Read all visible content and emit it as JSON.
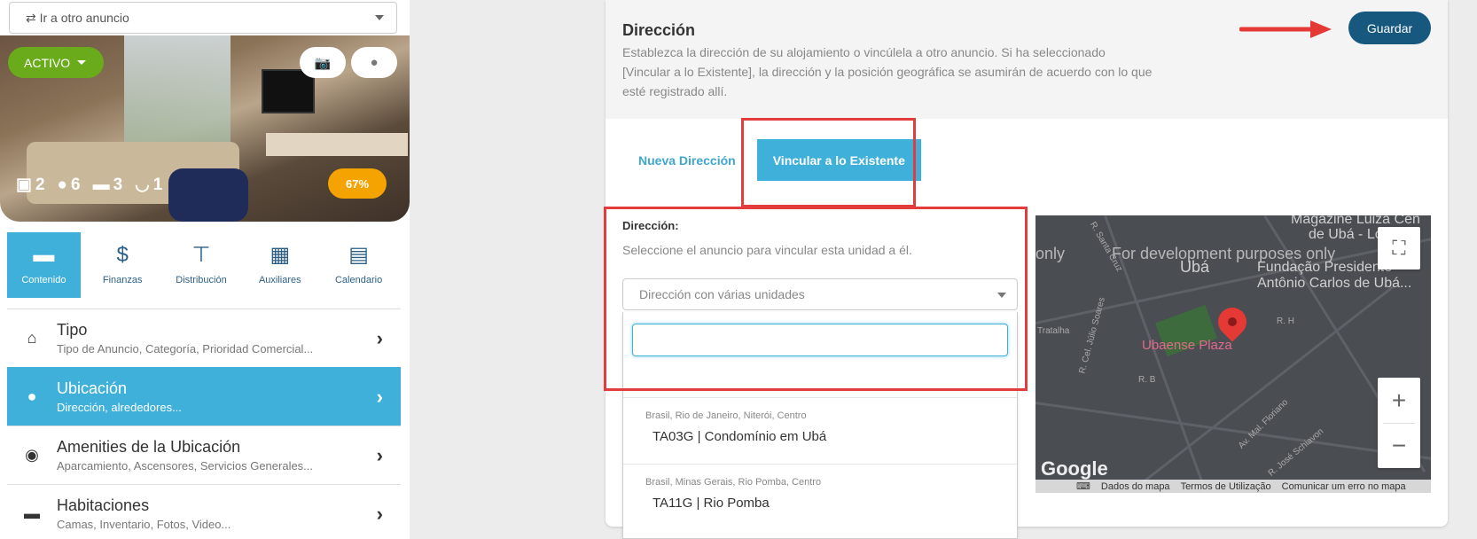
{
  "sidebar": {
    "goto_label": "⇄ Ir a otro anuncio",
    "status_label": "ACTIVO",
    "stats": {
      "rooms": "2",
      "guests": "6",
      "beds": "3",
      "baths": "1"
    },
    "completion": "67%",
    "tabs": [
      {
        "label": "Contenido",
        "icon": "bed-icon"
      },
      {
        "label": "Finanzas",
        "icon": "dollar-icon"
      },
      {
        "label": "Distribución",
        "icon": "sitemap-icon"
      },
      {
        "label": "Auxiliares",
        "icon": "cubes-icon"
      },
      {
        "label": "Calendario",
        "icon": "calendar-icon"
      }
    ],
    "menu": [
      {
        "title": "Tipo",
        "subtitle": "Tipo de Anuncio, Categoría, Prioridad Comercial...",
        "icon": "home-icon"
      },
      {
        "title": "Ubicación",
        "subtitle": "Dirección, alrededores...",
        "icon": "map-marker-icon"
      },
      {
        "title": "Amenities de la Ubicación",
        "subtitle": "Aparcamiento, Ascensores, Servicios Generales...",
        "icon": "target-icon"
      },
      {
        "title": "Habitaciones",
        "subtitle": "Camas, Inventario, Fotos, Video...",
        "icon": "bed-icon"
      }
    ]
  },
  "panel": {
    "title": "Dirección",
    "description": "Establezca la dirección de su alojamiento o vincúlela a otro anuncio. Si ha seleccionado [Vincular a lo Existente], la dirección y la posición geográfica se asumirán de acuerdo con lo que esté registrado allí.",
    "save_label": "Guardar",
    "tab_new": "Nueva Dirección",
    "tab_link": "Vincular a lo Existente",
    "field_label": "Dirección:",
    "field_hint": "Seleccione el anuncio para vincular esta unidad a él.",
    "select_placeholder": "Dirección con várias unidades",
    "options": [
      {
        "location": "Brasil, Rio de Janeiro, Niterói, Centro",
        "name": "TA03G | Condomínio em Ubá"
      },
      {
        "location": "Brasil, Minas Gerais, Rio Pomba, Centro",
        "name": "TA11G | Rio Pomba"
      }
    ]
  },
  "map": {
    "dev_text": "For development purposes only",
    "dev_text_left": "only",
    "city": "Ubá",
    "labels": [
      "Magazine Luiza Cen",
      "de Ubá - Loj",
      "Fundação Presidente",
      "Antônio Carlos de Ubá..."
    ],
    "poi": "Ubaense Plaza",
    "streets": [
      "R. Cel. Júlio Soares",
      "R. Santa Cruz",
      "R. H",
      "R. B",
      "Av. Mal. Floriano",
      "R. José Schiavon",
      "Tratalha"
    ],
    "footer": [
      "Dados do mapa",
      "Termos de Utilização",
      "Comunicar um erro no mapa"
    ],
    "brand": "Google"
  }
}
